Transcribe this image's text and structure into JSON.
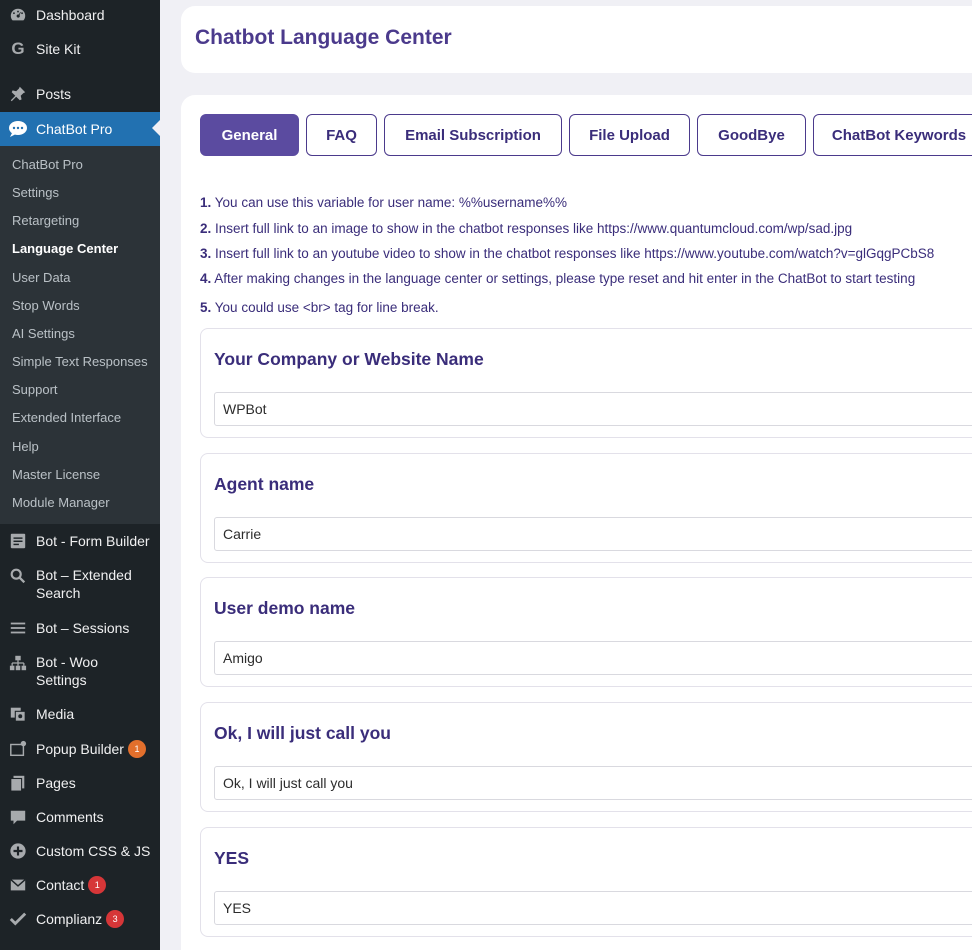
{
  "sidebar": {
    "top_items": [
      {
        "label": "Dashboard",
        "icon": "dashboard-icon"
      },
      {
        "label": "Site Kit",
        "icon": "google-g-icon"
      },
      {
        "label": "Posts",
        "icon": "pin-icon"
      },
      {
        "label": "ChatBot Pro",
        "icon": "chat-bubble-icon"
      }
    ],
    "submenu": [
      "ChatBot Pro",
      "Settings",
      "Retargeting",
      "Language Center",
      "User Data",
      "Stop Words",
      "AI Settings",
      "Simple Text Responses",
      "Support",
      "Extended Interface",
      "Help",
      "Master License",
      "Module Manager"
    ],
    "active_submenu": "Language Center",
    "bottom_items": [
      {
        "label": "Bot - Form Builder",
        "icon": "form-icon"
      },
      {
        "label": "Bot – Extended Search",
        "icon": "search-icon"
      },
      {
        "label": "Bot – Sessions",
        "icon": "list-icon"
      },
      {
        "label": "Bot - Woo Settings",
        "icon": "sitemap-icon"
      },
      {
        "label": "Media",
        "icon": "media-icon"
      },
      {
        "label": "Popup Builder",
        "icon": "popup-icon",
        "badge": "1"
      },
      {
        "label": "Pages",
        "icon": "pages-icon"
      },
      {
        "label": "Comments",
        "icon": "comment-icon"
      },
      {
        "label": "Custom CSS & JS",
        "icon": "plus-circle-icon"
      },
      {
        "label": "Contact",
        "icon": "mail-icon",
        "badge": "1"
      },
      {
        "label": "Complianz",
        "icon": "check-icon",
        "badge": "3"
      }
    ]
  },
  "header": {
    "title": "Chatbot Language Center"
  },
  "tabs": [
    "General",
    "FAQ",
    "Email Subscription",
    "File Upload",
    "GoodBye",
    "ChatBot Keywords"
  ],
  "active_tab": "General",
  "instructions": [
    {
      "num": "1.",
      "text": "You can use this variable for user name: %%username%%"
    },
    {
      "num": "2.",
      "text": "Insert full link to an image to show in the chatbot responses like https://www.quantumcloud.com/wp/sad.jpg"
    },
    {
      "num": "3.",
      "text": "Insert full link to an youtube video to show in the chatbot responses like https://www.youtube.com/watch?v=glGqgPCbS8"
    },
    {
      "num": "4.",
      "text": "After making changes in the language center or settings, please type reset and hit enter in the ChatBot to start testing"
    },
    {
      "num": "5.",
      "text": "You could use <br> tag for line break."
    }
  ],
  "fields": [
    {
      "label": "Your Company or Website Name",
      "value": "WPBot"
    },
    {
      "label": "Agent name",
      "value": "Carrie"
    },
    {
      "label": "User demo name",
      "value": "Amigo"
    },
    {
      "label": "Ok, I will just call you",
      "value": "Ok, I will just call you"
    },
    {
      "label": "YES",
      "value": "YES"
    }
  ],
  "colors": {
    "accent": "#5b4ba0",
    "title": "#4b3a8c",
    "sidebar": "#1d2327",
    "current_menu": "#2271b1",
    "badge": "#d63638"
  }
}
